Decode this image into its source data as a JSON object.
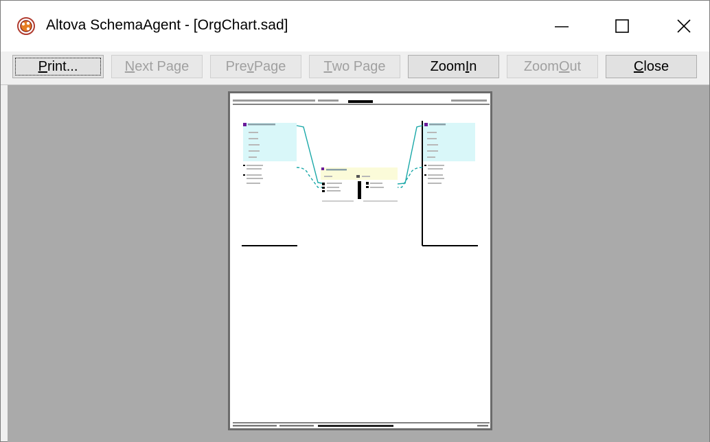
{
  "window": {
    "title": "Altova SchemaAgent - [OrgChart.sad]",
    "controls": {
      "minimize": "minimize",
      "maximize": "maximize",
      "close": "close"
    }
  },
  "toolbar": {
    "print": {
      "pre": "",
      "ul": "P",
      "post": "rint..."
    },
    "next_page": {
      "pre": "",
      "ul": "N",
      "post": "ext Page"
    },
    "prev_page": {
      "pre": "Pre",
      "ul": "v",
      "post": " Page"
    },
    "two_page": {
      "pre": "",
      "ul": "T",
      "post": "wo Page"
    },
    "zoom_in": {
      "pre": "Zoom ",
      "ul": "I",
      "post": "n"
    },
    "zoom_out": {
      "pre": "Zoom ",
      "ul": "O",
      "post": "ut"
    },
    "close": {
      "pre": "",
      "ul": "C",
      "post": "lose"
    }
  },
  "colors": {
    "preview_bg": "#aaaaaa",
    "schema_box": "#d9f7f9",
    "center_box": "#fbfbd9",
    "connector": "#1aa8a8"
  }
}
